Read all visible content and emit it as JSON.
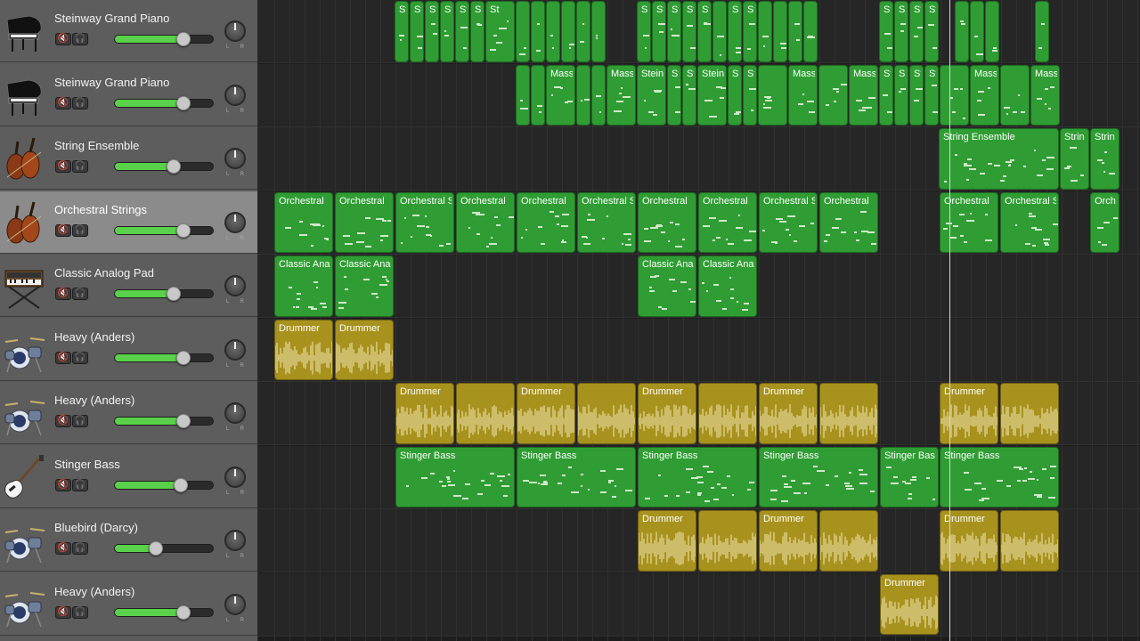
{
  "tracks": [
    {
      "name": "Steinway Grand Piano",
      "icon": "grand-piano-icon",
      "volume": 0.7
    },
    {
      "name": "Steinway Grand Piano",
      "icon": "grand-piano-icon",
      "volume": 0.7
    },
    {
      "name": "String Ensemble",
      "icon": "cello-icon",
      "volume": 0.6
    },
    {
      "name": "Orchestral Strings",
      "icon": "cello-icon",
      "volume": 0.7,
      "selected": true
    },
    {
      "name": "Classic Analog Pad",
      "icon": "synthesizer-icon",
      "volume": 0.6
    },
    {
      "name": "Heavy (Anders)",
      "icon": "drum-kit-icon",
      "volume": 0.7
    },
    {
      "name": "Heavy (Anders)",
      "icon": "drum-kit-icon",
      "volume": 0.7
    },
    {
      "name": "Stinger Bass",
      "icon": "bass-guitar-icon",
      "volume": 0.67
    },
    {
      "name": "Bluebird (Darcy)",
      "icon": "drum-kit-icon",
      "volume": 0.42
    },
    {
      "name": "Heavy (Anders)",
      "icon": "drum-kit-icon",
      "volume": 0.7
    }
  ],
  "track_buttons": {
    "mute_glyph": "🔇",
    "solo_glyph": "🎧"
  },
  "pan_labels": {
    "left": "L",
    "right": "R"
  },
  "regions": [
    {
      "track": 0,
      "type": "midi",
      "label": "St"
    },
    {
      "track": 0,
      "type": "midi",
      "label": "St"
    },
    {
      "track": 0,
      "type": "midi",
      "label": "St"
    },
    {
      "track": 0,
      "type": "midi",
      "label": "St"
    },
    {
      "track": 0,
      "type": "midi",
      "label": "St"
    },
    {
      "track": 0,
      "type": "midi",
      "label": "S"
    },
    {
      "track": 0,
      "type": "midi",
      "label": "St"
    },
    {
      "track": 0,
      "type": "midi",
      "label": ""
    },
    {
      "track": 0,
      "type": "midi",
      "label": ""
    },
    {
      "track": 0,
      "type": "midi",
      "label": ""
    },
    {
      "track": 0,
      "type": "midi",
      "label": ""
    },
    {
      "track": 0,
      "type": "midi",
      "label": ""
    },
    {
      "track": 0,
      "type": "midi",
      "label": ""
    },
    {
      "track": 0,
      "type": "midi",
      "label": "S"
    },
    {
      "track": 0,
      "type": "midi",
      "label": "St"
    },
    {
      "track": 0,
      "type": "midi",
      "label": "St"
    },
    {
      "track": 0,
      "type": "midi",
      "label": "St"
    },
    {
      "track": 0,
      "type": "midi",
      "label": "St"
    },
    {
      "track": 0,
      "type": "midi",
      "label": ""
    },
    {
      "track": 0,
      "type": "midi",
      "label": "S"
    },
    {
      "track": 0,
      "type": "midi",
      "label": "St"
    },
    {
      "track": 0,
      "type": "midi",
      "label": ""
    },
    {
      "track": 0,
      "type": "midi",
      "label": ""
    },
    {
      "track": 0,
      "type": "midi",
      "label": ""
    },
    {
      "track": 0,
      "type": "midi",
      "label": ""
    },
    {
      "track": 0,
      "type": "midi",
      "label": "St"
    },
    {
      "track": 0,
      "type": "midi",
      "label": "S"
    },
    {
      "track": 0,
      "type": "midi",
      "label": "St"
    },
    {
      "track": 0,
      "type": "midi",
      "label": "St"
    },
    {
      "track": 0,
      "type": "midi",
      "label": ""
    },
    {
      "track": 0,
      "type": "midi",
      "label": ""
    },
    {
      "track": 0,
      "type": "midi",
      "label": ""
    },
    {
      "track": 0,
      "type": "midi",
      "label": ""
    },
    {
      "track": 1,
      "type": "midi",
      "label": ""
    },
    {
      "track": 1,
      "type": "midi",
      "label": ""
    },
    {
      "track": 1,
      "type": "midi",
      "label": "Mass"
    },
    {
      "track": 1,
      "type": "midi",
      "label": ""
    },
    {
      "track": 1,
      "type": "midi",
      "label": ""
    },
    {
      "track": 1,
      "type": "midi",
      "label": "Mass"
    },
    {
      "track": 1,
      "type": "midi",
      "label": "Stein"
    },
    {
      "track": 1,
      "type": "midi",
      "label": "St"
    },
    {
      "track": 1,
      "type": "midi",
      "label": "St"
    },
    {
      "track": 1,
      "type": "midi",
      "label": "Stein"
    },
    {
      "track": 1,
      "type": "midi",
      "label": "S"
    },
    {
      "track": 1,
      "type": "midi",
      "label": "St"
    },
    {
      "track": 1,
      "type": "midi",
      "label": ""
    },
    {
      "track": 1,
      "type": "midi",
      "label": "Mass"
    },
    {
      "track": 1,
      "type": "midi",
      "label": ""
    },
    {
      "track": 1,
      "type": "midi",
      "label": "Mass"
    },
    {
      "track": 1,
      "type": "midi",
      "label": "St"
    },
    {
      "track": 1,
      "type": "midi",
      "label": "S"
    },
    {
      "track": 1,
      "type": "midi",
      "label": "St"
    },
    {
      "track": 1,
      "type": "midi",
      "label": "St"
    },
    {
      "track": 1,
      "type": "midi",
      "label": ""
    },
    {
      "track": 1,
      "type": "midi",
      "label": "Mass"
    },
    {
      "track": 1,
      "type": "midi",
      "label": ""
    },
    {
      "track": 1,
      "type": "midi",
      "label": "Mass"
    },
    {
      "track": 2,
      "type": "midi",
      "label": "String Ensemble"
    },
    {
      "track": 2,
      "type": "midi",
      "label": "Strin"
    },
    {
      "track": 2,
      "type": "midi",
      "label": "Strin"
    },
    {
      "track": 3,
      "type": "midi",
      "label": "Orchestral"
    },
    {
      "track": 3,
      "type": "midi",
      "label": "Orchestral"
    },
    {
      "track": 3,
      "type": "midi",
      "label": "Orchestral S"
    },
    {
      "track": 3,
      "type": "midi",
      "label": "Orchestral"
    },
    {
      "track": 3,
      "type": "midi",
      "label": "Orchestral"
    },
    {
      "track": 3,
      "type": "midi",
      "label": "Orchestral S"
    },
    {
      "track": 3,
      "type": "midi",
      "label": "Orchestral"
    },
    {
      "track": 3,
      "type": "midi",
      "label": "Orchestral"
    },
    {
      "track": 3,
      "type": "midi",
      "label": "Orchestral S"
    },
    {
      "track": 3,
      "type": "midi",
      "label": "Orchestral"
    },
    {
      "track": 3,
      "type": "midi",
      "label": "Orchestral"
    },
    {
      "track": 3,
      "type": "midi",
      "label": "Orchestral S"
    },
    {
      "track": 3,
      "type": "midi",
      "label": "Orch"
    },
    {
      "track": 4,
      "type": "midi",
      "label": "Classic Anal"
    },
    {
      "track": 4,
      "type": "midi",
      "label": "Classic Anal"
    },
    {
      "track": 4,
      "type": "midi",
      "label": "Classic Anal"
    },
    {
      "track": 4,
      "type": "midi",
      "label": "Classic Anal"
    },
    {
      "track": 5,
      "type": "audio",
      "label": "Drummer"
    },
    {
      "track": 5,
      "type": "audio",
      "label": "Drummer"
    },
    {
      "track": 6,
      "type": "audio",
      "label": "Drummer"
    },
    {
      "track": 6,
      "type": "audio",
      "label": ""
    },
    {
      "track": 6,
      "type": "audio",
      "label": "Drummer"
    },
    {
      "track": 6,
      "type": "audio",
      "label": ""
    },
    {
      "track": 6,
      "type": "audio",
      "label": "Drummer"
    },
    {
      "track": 6,
      "type": "audio",
      "label": ""
    },
    {
      "track": 6,
      "type": "audio",
      "label": "Drummer"
    },
    {
      "track": 6,
      "type": "audio",
      "label": ""
    },
    {
      "track": 6,
      "type": "audio",
      "label": "Drummer"
    },
    {
      "track": 6,
      "type": "audio",
      "label": ""
    },
    {
      "track": 7,
      "type": "midi",
      "label": "Stinger Bass"
    },
    {
      "track": 7,
      "type": "midi",
      "label": "Stinger Bass"
    },
    {
      "track": 7,
      "type": "midi",
      "label": "Stinger Bass"
    },
    {
      "track": 7,
      "type": "midi",
      "label": "Stinger Bass"
    },
    {
      "track": 7,
      "type": "midi",
      "label": "Stinger Bas"
    },
    {
      "track": 7,
      "type": "midi",
      "label": "Stinger Bass"
    },
    {
      "track": 8,
      "type": "audio",
      "label": "Drummer"
    },
    {
      "track": 8,
      "type": "audio",
      "label": ""
    },
    {
      "track": 8,
      "type": "audio",
      "label": "Drummer"
    },
    {
      "track": 8,
      "type": "audio",
      "label": ""
    },
    {
      "track": 8,
      "type": "audio",
      "label": "Drummer"
    },
    {
      "track": 8,
      "type": "audio",
      "label": ""
    },
    {
      "track": 9,
      "type": "audio",
      "label": "Drummer"
    }
  ],
  "colors": {
    "midi_region": "#2f9d33",
    "audio_region": "#a8921e",
    "volume_fill": "#59d14a",
    "selected_header": "#8b8b8b"
  }
}
